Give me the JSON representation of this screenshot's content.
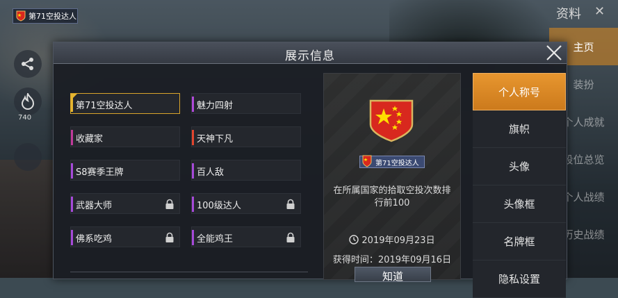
{
  "background": {
    "player_badge": "第71空投达人",
    "fire_count": "740",
    "menu_title": "资料",
    "menu_items": [
      "主页",
      "装扮",
      "个人成就",
      "段位总览",
      "个人战绩",
      "历史战绩"
    ]
  },
  "dialog": {
    "title": "展示信息",
    "titles": [
      {
        "name": "第71空投达人",
        "color": "#e6b630",
        "locked": false,
        "selected": true
      },
      {
        "name": "魅力四射",
        "color": "#b04ad8",
        "locked": false,
        "selected": false
      },
      {
        "name": "收藏家",
        "color": "#c03a9a",
        "locked": false,
        "selected": false
      },
      {
        "name": "天神下凡",
        "color": "#e2452e",
        "locked": false,
        "selected": false
      },
      {
        "name": "S8赛季王牌",
        "color": "#a64ad8",
        "locked": false,
        "selected": false
      },
      {
        "name": "百人敌",
        "color": "#a64ad8",
        "locked": false,
        "selected": false
      },
      {
        "name": "武器大师",
        "color": "#a64ad8",
        "locked": true,
        "selected": false
      },
      {
        "name": "100级达人",
        "color": "#a64ad8",
        "locked": true,
        "selected": false
      },
      {
        "name": "佛系吃鸡",
        "color": "#a64ad8",
        "locked": true,
        "selected": false
      },
      {
        "name": "全能鸡王",
        "color": "#a64ad8",
        "locked": true,
        "selected": false
      }
    ],
    "detail": {
      "badge_text": "第71空投达人",
      "description": "在所属国家的拾取空投次数排行前100",
      "expiry_date": "2019年09月23日",
      "obtained": "获得时间：2019年09月16日",
      "button": "知道"
    },
    "tabs": [
      "个人称号",
      "旗帜",
      "头像",
      "头像框",
      "名牌框",
      "隐私设置"
    ],
    "active_tab": 0
  },
  "colors": {
    "accent": "#e1902a",
    "flag_red": "#d8281e",
    "flag_star": "#ffde00"
  }
}
